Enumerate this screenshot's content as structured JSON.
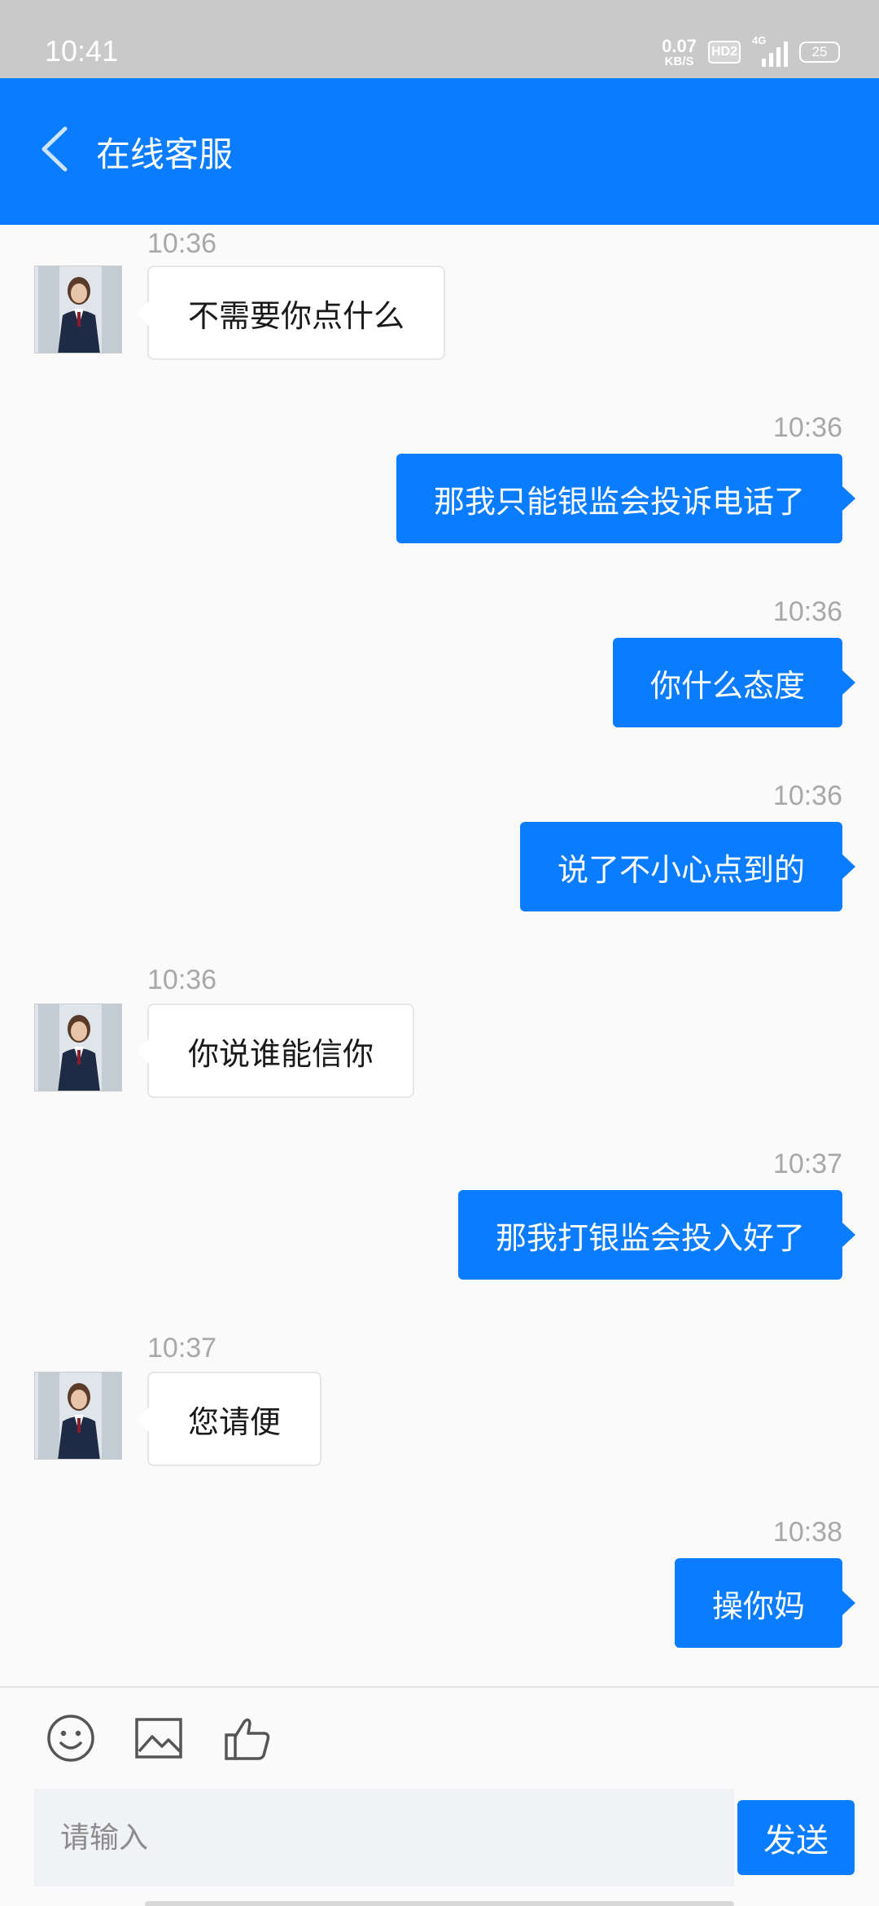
{
  "status_bar": {
    "time": "10:41",
    "net_speed_value": "0.07",
    "net_speed_unit": "KB/S",
    "hd_label": "HD2",
    "network_type": "4G",
    "battery": "25"
  },
  "header": {
    "title": "在线客服",
    "back_icon": "chevron-left-icon",
    "background_color": "#0a7cff"
  },
  "messages": [
    {
      "side": "in",
      "time": "10:36",
      "text": "不需要你点什么"
    },
    {
      "side": "out",
      "time": "10:36",
      "text": "那我只能银监会投诉电话了"
    },
    {
      "side": "out",
      "time": "10:36",
      "text": "你什么态度"
    },
    {
      "side": "out",
      "time": "10:36",
      "text": "说了不小心点到的"
    },
    {
      "side": "in",
      "time": "10:36",
      "text": "你说谁能信你"
    },
    {
      "side": "out",
      "time": "10:37",
      "text": "那我打银监会投入好了"
    },
    {
      "side": "in",
      "time": "10:37",
      "text": "您请便"
    },
    {
      "side": "out",
      "time": "10:38",
      "text": "操你妈"
    }
  ],
  "toolbar": {
    "icons": [
      "emoji-icon",
      "image-icon",
      "thumbs-up-icon"
    ],
    "input_placeholder": "请输入",
    "input_value": "",
    "send_label": "发送"
  },
  "colors": {
    "accent": "#0a7cff",
    "incoming_bubble": "#ffffff",
    "timestamp": "#a8a8a8"
  }
}
